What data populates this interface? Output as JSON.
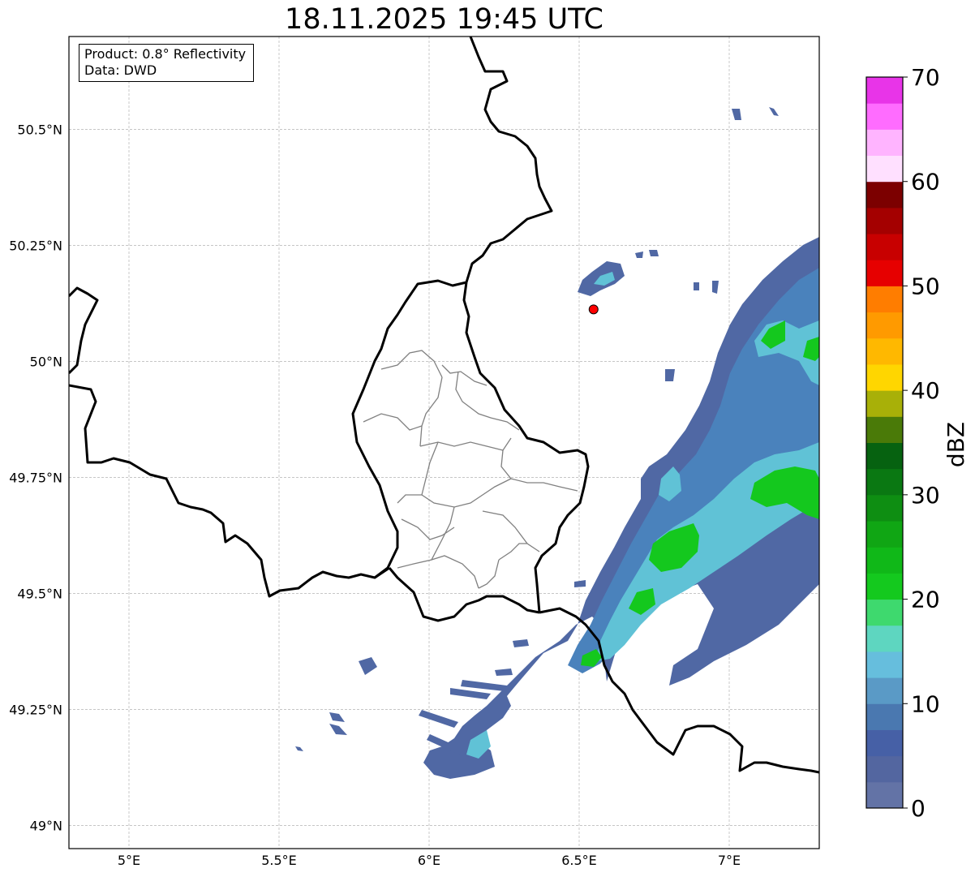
{
  "title": "18.11.2025 19:45 UTC",
  "info": {
    "product": "Product: 0.8° Reflectivity",
    "source": "Data: DWD"
  },
  "map_extent": {
    "lon": [
      4.8,
      7.3
    ],
    "lat": [
      48.95,
      50.7
    ]
  },
  "lon_ticks": [
    {
      "value": 5.0,
      "label": "5°E"
    },
    {
      "value": 5.5,
      "label": "5.5°E"
    },
    {
      "value": 6.0,
      "label": "6°E"
    },
    {
      "value": 6.5,
      "label": "6.5°E"
    },
    {
      "value": 7.0,
      "label": "7°E"
    }
  ],
  "lat_ticks": [
    {
      "value": 49.0,
      "label": "49°N"
    },
    {
      "value": 49.25,
      "label": "49.25°N"
    },
    {
      "value": 49.5,
      "label": "49.5°N"
    },
    {
      "value": 49.75,
      "label": "49.75°N"
    },
    {
      "value": 50.0,
      "label": "50°N"
    },
    {
      "value": 50.25,
      "label": "50.25°N"
    },
    {
      "value": 50.5,
      "label": "50.5°N"
    }
  ],
  "radar_site": {
    "lon": 6.548,
    "lat": 50.112,
    "color": "#ff0000"
  },
  "colorbar": {
    "label": "dBZ",
    "min": 0,
    "max": 70,
    "ticks": [
      {
        "value": 0,
        "label": "0"
      },
      {
        "value": 10,
        "label": "10"
      },
      {
        "value": 20,
        "label": "20"
      },
      {
        "value": 30,
        "label": "30"
      },
      {
        "value": 40,
        "label": "40"
      },
      {
        "value": 50,
        "label": "50"
      },
      {
        "value": 60,
        "label": "60"
      },
      {
        "value": 70,
        "label": "70"
      }
    ],
    "colors": [
      "#6373a6",
      "#5366a0",
      "#4660a6",
      "#4a78b0",
      "#5a9ac6",
      "#66bedd",
      "#5ed6c0",
      "#3ed96e",
      "#14c91e",
      "#10b818",
      "#10a614",
      "#0e8e12",
      "#0a7812",
      "#066210",
      "#4a7a08",
      "#a8b008",
      "#ffd600",
      "#ffb800",
      "#ff9a00",
      "#ff7d00",
      "#e60000",
      "#c80000",
      "#a40000",
      "#7c0000",
      "#ffe0ff",
      "#ffb4ff",
      "#ff6cff",
      "#e834e8"
    ]
  },
  "echo_colors": {
    "weak": "#5068a4",
    "light": "#4a82bc",
    "medium": "#60c2d6",
    "moderate": "#3ed98a",
    "strong": "#14c81e"
  }
}
